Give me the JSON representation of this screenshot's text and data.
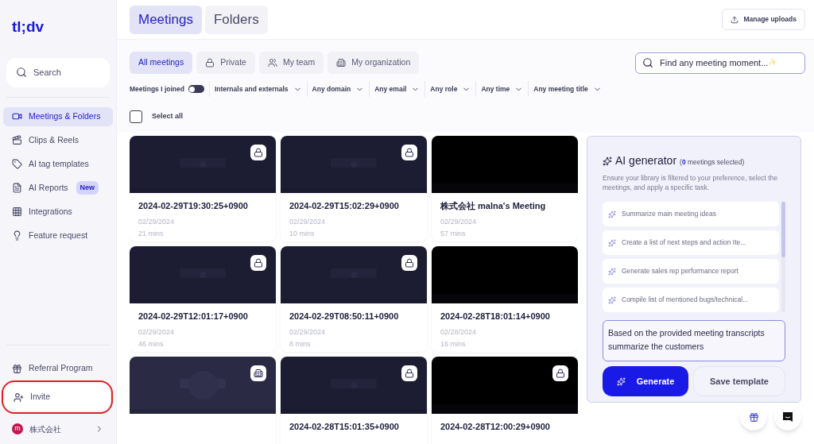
{
  "logo": "tl;dv",
  "sidebar": {
    "search": "Search",
    "items": [
      {
        "label": "Meetings & Folders",
        "selected": true
      },
      {
        "label": "Clips & Reels",
        "selected": false
      },
      {
        "label": "AI tag templates",
        "selected": false
      },
      {
        "label": "AI Reports",
        "selected": false,
        "badge": "New"
      },
      {
        "label": "Integrations",
        "selected": false
      },
      {
        "label": "Feature request",
        "selected": false
      }
    ],
    "bottom_items": [
      {
        "label": "Referral Program",
        "highlighted": false
      },
      {
        "label": "Invite",
        "highlighted": true
      }
    ],
    "account": {
      "initial": "m",
      "name": "株式会社"
    }
  },
  "tabs": [
    {
      "label": "Meetings",
      "selected": true
    },
    {
      "label": "Folders",
      "selected": false
    }
  ],
  "manage_uploads": "Manage uploads",
  "scopes": [
    {
      "label": "All meetings",
      "selected": true
    },
    {
      "label": "Private",
      "selected": false
    },
    {
      "label": "My team",
      "selected": false
    },
    {
      "label": "My organization",
      "selected": false
    }
  ],
  "search": {
    "placeholder": "Find any meeting moment...",
    "sparkle": "✨"
  },
  "filters": {
    "joined": {
      "label": "Meetings I joined",
      "on": false
    },
    "dropdowns": [
      "Internals and externals",
      "Any domain",
      "Any email",
      "Any role",
      "Any time",
      "Any meeting title"
    ]
  },
  "select_all": {
    "label": "Select all",
    "checked": false
  },
  "meetings": [
    {
      "title": "2024-02-29T19:30:25+0900",
      "date": "02/29/2024",
      "duration": "21 mins",
      "kind": "private"
    },
    {
      "title": "2024-02-29T15:02:29+0900",
      "date": "02/29/2024",
      "duration": "10 mins",
      "kind": "private"
    },
    {
      "title": "株式会社 malna's Meeting",
      "date": "02/29/2024",
      "duration": "57 mins",
      "kind": "plain"
    },
    {
      "title": "2024-02-29T12:01:17+0900",
      "date": "02/29/2024",
      "duration": "46 mins",
      "kind": "private"
    },
    {
      "title": "2024-02-29T08:50:11+0900",
      "date": "02/29/2024",
      "duration": "8 mins",
      "kind": "private"
    },
    {
      "title": "2024-02-28T18:01:14+0900",
      "date": "02/28/2024",
      "duration": "16 mins",
      "kind": "plain"
    },
    {
      "kind": "organization"
    },
    {
      "title": "2024-02-28T15:01:35+0900",
      "kind": "private"
    },
    {
      "title": "2024-02-28T12:00:29+0900",
      "kind": "private"
    }
  ],
  "ai_generator": {
    "title": "AI generator",
    "count": "0",
    "count_suffix": "meetings selected)",
    "count_prefix": "(",
    "description": "Ensure your library is filtered to your preference, select the meetings, and apply a specific task.",
    "prompts": [
      "Summarize main meeting ideas",
      "Create a list of next steps and action Ite...",
      "Generate sales rep performance report",
      "Compile list of mentioned bugs/technical..."
    ],
    "prompt_text": "Based on the provided meeting transcripts summarize the customers",
    "generate": "Generate",
    "save": "Save template"
  }
}
